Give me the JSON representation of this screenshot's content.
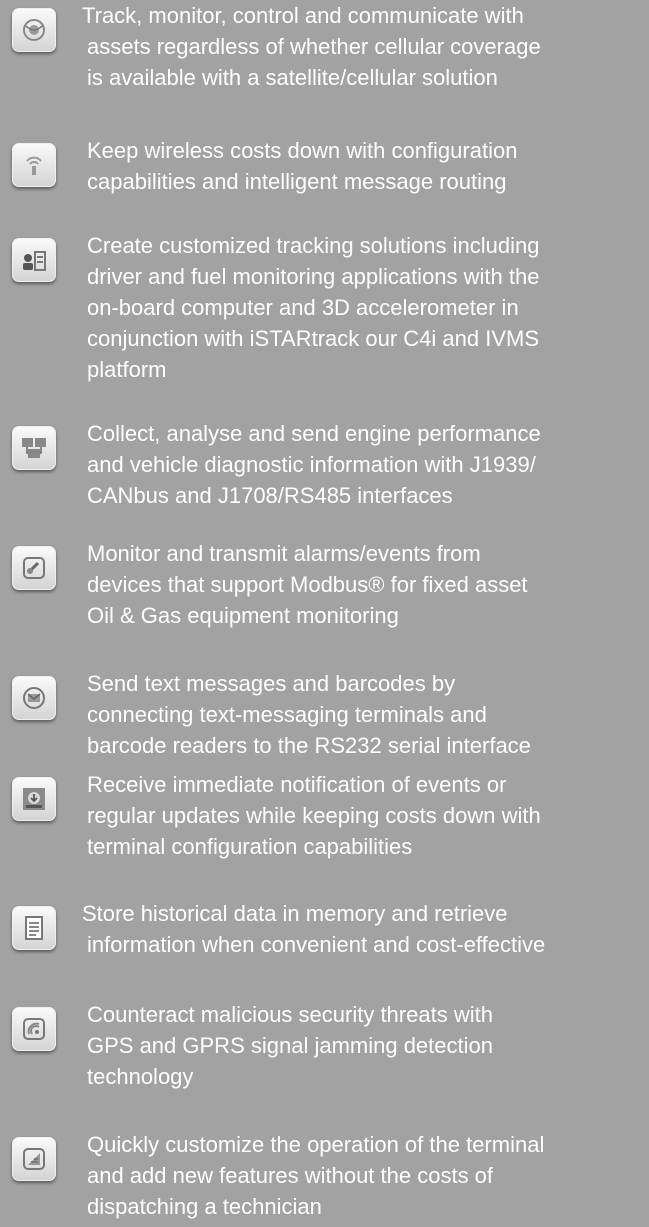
{
  "features": [
    {
      "icon": "satellite-globe-icon",
      "lines": [
        "Track, monitor, control and communicate with",
        "assets regardless of whether cellular coverage",
        "is available with a satellite/cellular solution"
      ]
    },
    {
      "icon": "wireless-antenna-icon",
      "lines": [
        "Keep wireless costs down with configuration",
        "capabilities and intelligent message routing"
      ]
    },
    {
      "icon": "driver-tracking-icon",
      "lines": [
        "Create customized tracking solutions including",
        "driver and fuel monitoring applications with the",
        "on-board computer and 3D accelerometer in",
        "conjunction with iSTARtrack our C4i and IVMS",
        "platform"
      ]
    },
    {
      "icon": "network-monitors-icon",
      "lines": [
        "Collect, analyse and send engine performance",
        "and vehicle diagnostic information with J1939/",
        "CANbus and J1708/RS485 interfaces"
      ]
    },
    {
      "icon": "alarm-gauge-icon",
      "lines": [
        "Monitor and transmit alarms/events from",
        "devices that support Modbus® for fixed asset",
        "Oil & Gas equipment monitoring"
      ]
    },
    {
      "icon": "envelope-message-icon",
      "lines": [
        "Send text messages and barcodes by",
        "connecting text-messaging terminals and",
        "barcode readers to the RS232 serial interface"
      ]
    },
    {
      "icon": "notification-download-icon",
      "lines": [
        "Receive immediate notification of events or",
        "regular updates while keeping costs down with",
        "terminal configuration capabilities"
      ]
    },
    {
      "icon": "document-storage-icon",
      "lines": [
        "Store historical data in memory and retrieve",
        "information when convenient and cost-effective"
      ]
    },
    {
      "icon": "signal-jamming-icon",
      "lines": [
        "Counteract malicious security threats with",
        "GPS and GPRS signal jamming detection",
        "technology"
      ]
    },
    {
      "icon": "customize-keyboard-icon",
      "lines": [
        "Quickly customize the operation of the terminal",
        "and add new features without the costs of",
        "dispatching a technician"
      ]
    }
  ]
}
